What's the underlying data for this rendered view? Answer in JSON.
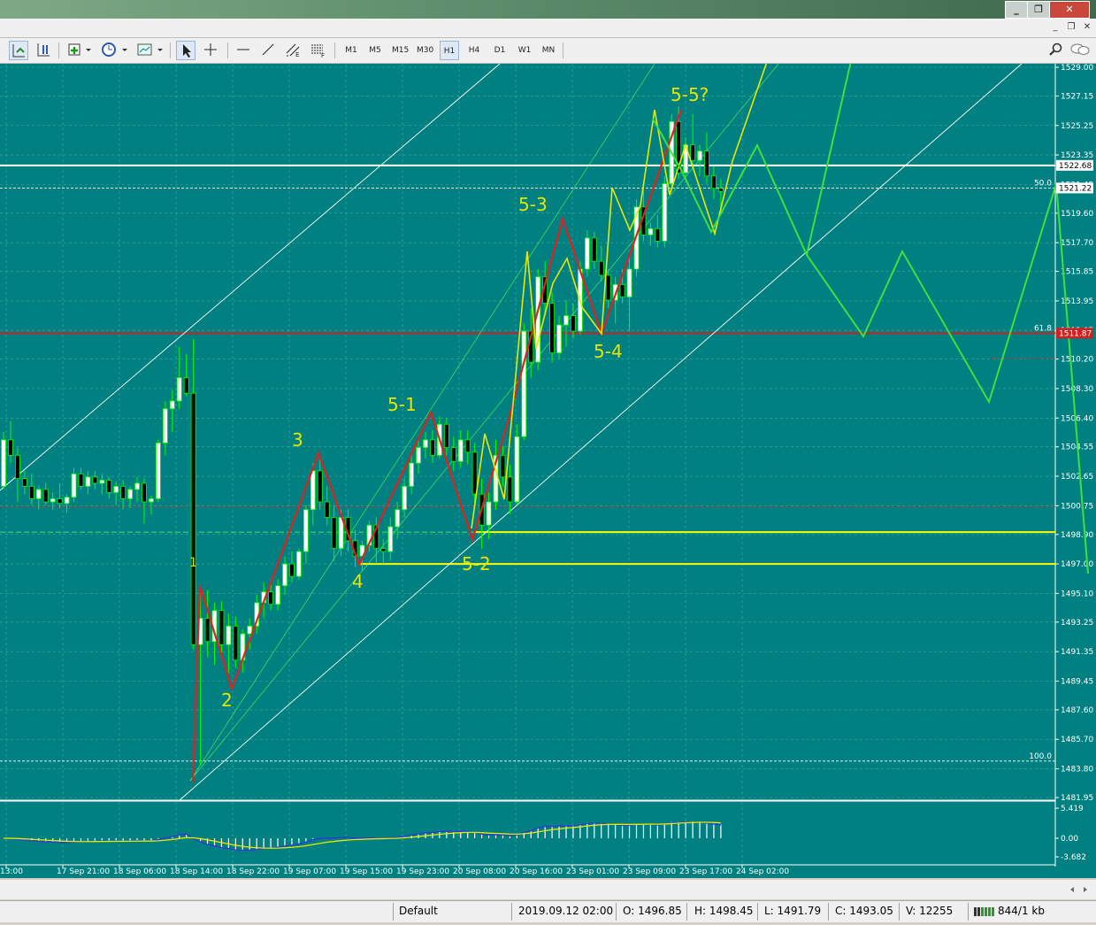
{
  "window": {
    "controls": {
      "minimize": "_",
      "restore": "❐",
      "close": "✕"
    },
    "inner_controls": {
      "minimize": "_",
      "restore": "❐",
      "close": "✕"
    }
  },
  "toolbar": {
    "timeframes": [
      "M1",
      "M5",
      "M15",
      "M30",
      "H1",
      "H4",
      "D1",
      "W1",
      "MN"
    ],
    "active_timeframe": "H1"
  },
  "chart_data": {
    "type": "candlestick",
    "y_axis": {
      "ticks": [
        "1529.00",
        "1527.15",
        "1525.25",
        "1523.35",
        "1521.45",
        "1519.60",
        "1517.70",
        "1515.85",
        "1513.95",
        "1512.05",
        "1510.20",
        "1508.30",
        "1506.40",
        "1504.55",
        "1502.65",
        "1500.75",
        "1498.90",
        "1497.00",
        "1495.10",
        "1493.25",
        "1491.35",
        "1489.45",
        "1487.60",
        "1485.70",
        "1483.80",
        "1481.95"
      ],
      "range": [
        1481.95,
        1529.0
      ]
    },
    "x_axis": {
      "ticks": [
        "13:00",
        "17 Sep 21:00",
        "18 Sep 06:00",
        "18 Sep 14:00",
        "18 Sep 22:00",
        "19 Sep 07:00",
        "19 Sep 15:00",
        "19 Sep 23:00",
        "20 Sep 08:00",
        "20 Sep 16:00",
        "23 Sep 01:00",
        "23 Sep 09:00",
        "23 Sep 17:00",
        "24 Sep 02:00"
      ]
    },
    "price_tags": [
      {
        "value": "1522.68",
        "color": "#ffffff"
      },
      {
        "value": "1521.22",
        "color": "#ffffff"
      },
      {
        "value": "1511.87",
        "color": "#cc2222"
      }
    ],
    "fib_levels": [
      {
        "label": "50.0",
        "price": 1521.22
      },
      {
        "label": "61.8",
        "price": 1511.87
      },
      {
        "label": "100.0",
        "price": 1484.3
      }
    ],
    "horizontal_lines": [
      {
        "name": "resistance",
        "price": 1522.68,
        "color": "#ffffff"
      },
      {
        "name": "support-upper",
        "price": 1499.05,
        "color": "#ffff00"
      },
      {
        "name": "support-lower",
        "price": 1497.0,
        "color": "#ffff00"
      }
    ],
    "wave_labels": [
      "5-5?",
      "5-3",
      "5-1",
      "5-4",
      "5-2",
      "3",
      "4",
      "2",
      "1"
    ],
    "indicator_ticks": [
      "5.419",
      "0.00",
      "-3.682"
    ],
    "candles": [
      [
        1502.0,
        1505.5,
        1501.8,
        1505.0
      ],
      [
        1505.0,
        1506.2,
        1503.5,
        1504.0
      ],
      [
        1504.0,
        1504.5,
        1501.0,
        1502.5
      ],
      [
        1502.5,
        1503.0,
        1501.5,
        1502.0
      ],
      [
        1502.0,
        1502.8,
        1500.8,
        1501.2
      ],
      [
        1501.2,
        1502.0,
        1500.5,
        1501.8
      ],
      [
        1501.8,
        1502.2,
        1500.8,
        1501.0
      ],
      [
        1501.0,
        1501.6,
        1500.5,
        1501.2
      ],
      [
        1501.2,
        1502.2,
        1500.6,
        1500.9
      ],
      [
        1500.9,
        1501.5,
        1500.3,
        1501.3
      ],
      [
        1501.3,
        1503.2,
        1501.0,
        1502.8
      ],
      [
        1502.8,
        1503.2,
        1501.8,
        1502.0
      ],
      [
        1502.0,
        1503.0,
        1501.5,
        1502.6
      ],
      [
        1502.6,
        1503.0,
        1501.8,
        1502.2
      ],
      [
        1502.2,
        1502.8,
        1501.5,
        1502.4
      ],
      [
        1502.4,
        1502.6,
        1501.2,
        1501.6
      ],
      [
        1501.6,
        1502.3,
        1500.8,
        1502.0
      ],
      [
        1502.0,
        1502.4,
        1500.5,
        1501.2
      ],
      [
        1501.2,
        1502.0,
        1500.6,
        1501.8
      ],
      [
        1501.8,
        1502.6,
        1501.0,
        1502.2
      ],
      [
        1502.2,
        1502.5,
        1499.6,
        1501.0
      ],
      [
        1501.0,
        1501.4,
        1500.2,
        1501.2
      ],
      [
        1501.2,
        1505.0,
        1501.0,
        1504.8
      ],
      [
        1504.8,
        1507.5,
        1504.0,
        1507.0
      ],
      [
        1507.0,
        1508.2,
        1505.5,
        1507.5
      ],
      [
        1507.5,
        1511.0,
        1507.0,
        1509.0
      ],
      [
        1509.0,
        1510.5,
        1507.8,
        1508.0
      ],
      [
        1508.0,
        1511.5,
        1491.5,
        1491.8
      ],
      [
        1491.8,
        1495.5,
        1484.0,
        1493.5
      ],
      [
        1493.5,
        1495.3,
        1491.0,
        1492.0
      ],
      [
        1492.0,
        1494.5,
        1490.5,
        1494.0
      ],
      [
        1494.0,
        1494.6,
        1491.2,
        1491.8
      ],
      [
        1491.8,
        1493.8,
        1490.0,
        1493.0
      ],
      [
        1493.0,
        1493.6,
        1490.3,
        1490.8
      ],
      [
        1490.8,
        1492.8,
        1490.0,
        1492.5
      ],
      [
        1492.5,
        1493.5,
        1491.5,
        1493.0
      ],
      [
        1493.0,
        1495.0,
        1492.5,
        1494.5
      ],
      [
        1494.5,
        1495.8,
        1493.5,
        1495.2
      ],
      [
        1495.2,
        1496.0,
        1494.0,
        1494.4
      ],
      [
        1494.4,
        1496.0,
        1494.0,
        1495.6
      ],
      [
        1495.6,
        1497.5,
        1495.0,
        1497.0
      ],
      [
        1497.0,
        1497.8,
        1495.8,
        1496.2
      ],
      [
        1496.2,
        1498.0,
        1496.0,
        1497.8
      ],
      [
        1497.8,
        1500.8,
        1497.0,
        1500.5
      ],
      [
        1500.5,
        1503.5,
        1499.5,
        1503.0
      ],
      [
        1503.0,
        1503.8,
        1500.5,
        1501.0
      ],
      [
        1501.0,
        1502.0,
        1499.5,
        1500.0
      ],
      [
        1500.0,
        1500.8,
        1497.2,
        1498.0
      ],
      [
        1498.0,
        1500.5,
        1497.5,
        1500.0
      ],
      [
        1500.0,
        1500.5,
        1497.8,
        1498.5
      ],
      [
        1498.5,
        1499.2,
        1496.8,
        1497.5
      ],
      [
        1497.5,
        1498.5,
        1496.5,
        1498.2
      ],
      [
        1498.2,
        1499.8,
        1497.8,
        1499.5
      ],
      [
        1499.5,
        1500.0,
        1497.0,
        1498.0
      ],
      [
        1498.0,
        1498.6,
        1497.0,
        1497.8
      ],
      [
        1497.8,
        1500.0,
        1497.2,
        1499.4
      ],
      [
        1499.4,
        1501.0,
        1498.6,
        1500.5
      ],
      [
        1500.5,
        1502.5,
        1500.0,
        1502.0
      ],
      [
        1502.0,
        1504.0,
        1501.5,
        1503.5
      ],
      [
        1503.5,
        1505.0,
        1502.8,
        1504.5
      ],
      [
        1504.5,
        1505.5,
        1503.8,
        1505.0
      ],
      [
        1505.0,
        1505.6,
        1503.5,
        1504.0
      ],
      [
        1504.0,
        1506.5,
        1503.8,
        1506.0
      ],
      [
        1506.0,
        1506.4,
        1504.0,
        1504.5
      ],
      [
        1504.5,
        1505.2,
        1503.0,
        1503.6
      ],
      [
        1503.6,
        1505.6,
        1503.2,
        1505.0
      ],
      [
        1505.0,
        1505.6,
        1503.4,
        1504.2
      ],
      [
        1504.2,
        1504.8,
        1500.8,
        1501.5
      ],
      [
        1501.5,
        1502.5,
        1498.0,
        1499.5
      ],
      [
        1499.5,
        1501.6,
        1498.6,
        1501.0
      ],
      [
        1501.0,
        1505.0,
        1500.5,
        1504.0
      ],
      [
        1504.0,
        1504.6,
        1502.0,
        1502.6
      ],
      [
        1502.6,
        1503.4,
        1500.2,
        1501.0
      ],
      [
        1501.0,
        1506.0,
        1500.8,
        1505.2
      ],
      [
        1505.2,
        1512.5,
        1505.0,
        1512.0
      ],
      [
        1512.0,
        1513.5,
        1509.0,
        1510.0
      ],
      [
        1510.0,
        1516.0,
        1509.5,
        1515.5
      ],
      [
        1515.5,
        1516.5,
        1513.0,
        1513.8
      ],
      [
        1513.8,
        1514.5,
        1510.0,
        1510.6
      ],
      [
        1510.6,
        1513.0,
        1510.2,
        1512.4
      ],
      [
        1512.4,
        1514.0,
        1511.0,
        1513.0
      ],
      [
        1513.0,
        1513.8,
        1511.5,
        1512.0
      ],
      [
        1512.0,
        1516.5,
        1511.8,
        1516.0
      ],
      [
        1516.0,
        1518.5,
        1515.5,
        1518.0
      ],
      [
        1518.0,
        1518.4,
        1516.0,
        1516.5
      ],
      [
        1516.5,
        1517.5,
        1515.2,
        1515.6
      ],
      [
        1515.6,
        1516.0,
        1513.5,
        1514.0
      ],
      [
        1514.0,
        1515.5,
        1512.5,
        1515.0
      ],
      [
        1515.0,
        1516.0,
        1513.8,
        1514.2
      ],
      [
        1514.2,
        1516.8,
        1512.0,
        1516.0
      ],
      [
        1516.0,
        1520.5,
        1515.5,
        1520.0
      ],
      [
        1520.0,
        1521.2,
        1517.8,
        1518.2
      ],
      [
        1518.2,
        1519.0,
        1517.5,
        1518.6
      ],
      [
        1518.6,
        1519.5,
        1517.4,
        1517.8
      ],
      [
        1517.8,
        1522.0,
        1517.4,
        1521.5
      ],
      [
        1521.5,
        1526.0,
        1521.0,
        1525.5
      ],
      [
        1525.5,
        1526.5,
        1521.8,
        1522.2
      ],
      [
        1522.2,
        1524.5,
        1521.8,
        1524.0
      ],
      [
        1524.0,
        1526.0,
        1522.5,
        1523.0
      ],
      [
        1523.0,
        1524.0,
        1522.0,
        1523.6
      ],
      [
        1523.6,
        1524.8,
        1521.5,
        1522.0
      ],
      [
        1522.0,
        1522.6,
        1520.5,
        1521.2
      ],
      [
        1521.2,
        1521.8,
        1519.6,
        1521.0
      ]
    ]
  }
}
